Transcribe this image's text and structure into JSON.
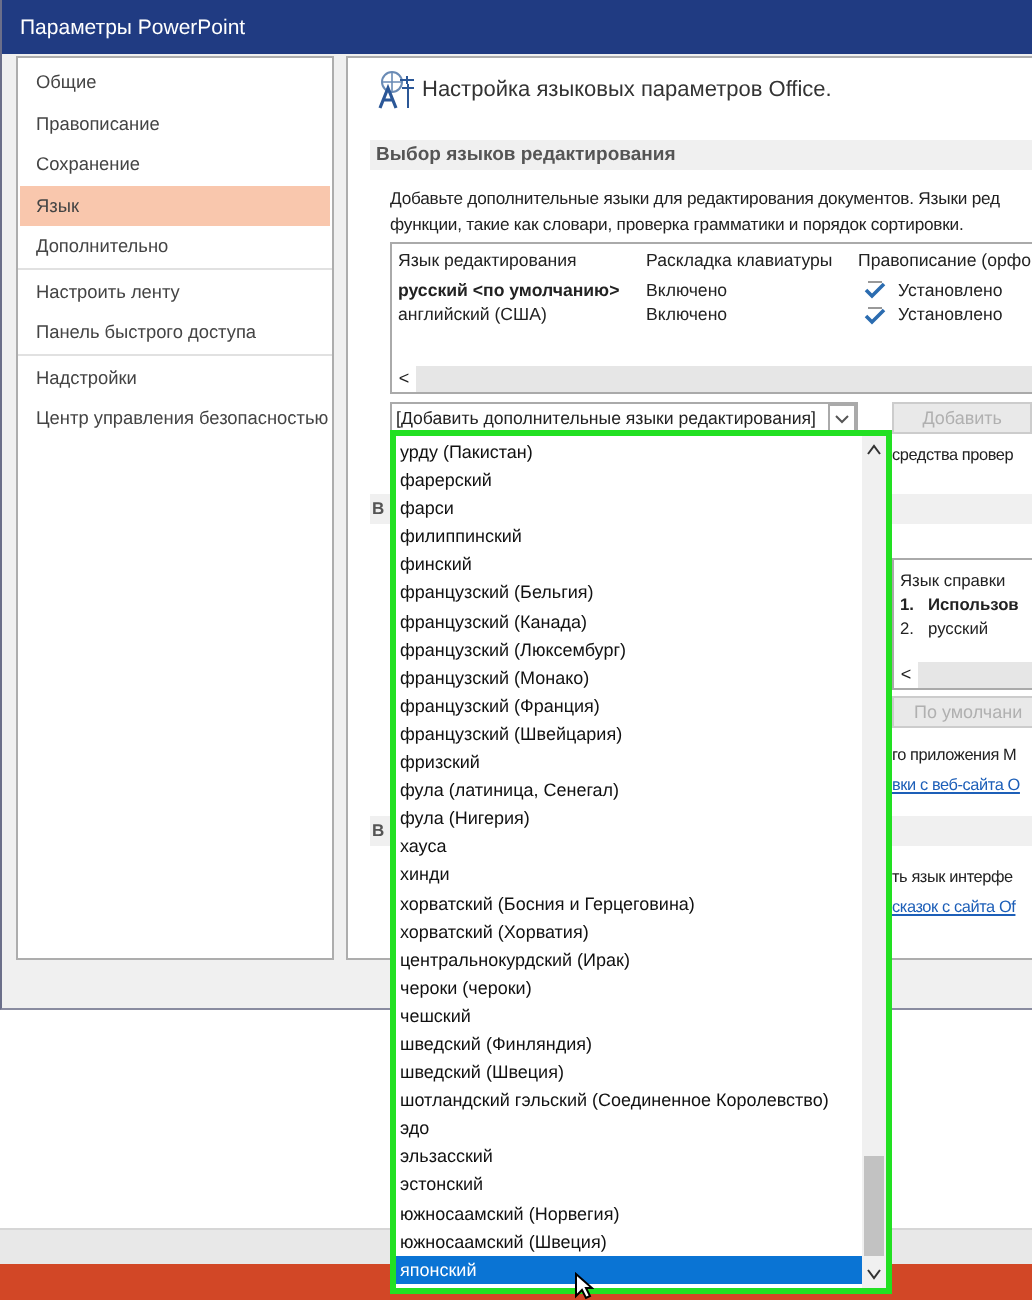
{
  "window": {
    "title": "Параметры PowerPoint"
  },
  "sidebar": {
    "groups": [
      [
        {
          "label": "Общие",
          "selected": false
        },
        {
          "label": "Правописание",
          "selected": false
        },
        {
          "label": "Сохранение",
          "selected": false
        },
        {
          "label": "Язык",
          "selected": true
        },
        {
          "label": "Дополнительно",
          "selected": false
        }
      ],
      [
        {
          "label": "Настроить ленту",
          "selected": false
        },
        {
          "label": "Панель быстрого доступа",
          "selected": false
        }
      ],
      [
        {
          "label": "Надстройки",
          "selected": false
        },
        {
          "label": "Центр управления безопасностью",
          "selected": false
        }
      ]
    ]
  },
  "main": {
    "heading": "Настройка языковых параметров Office.",
    "section_title": "Выбор языков редактирования",
    "description": [
      "Добавьте дополнительные языки для редактирования документов. Языки ред",
      "функции, такие как словари, проверка грамматики и порядок сортировки."
    ],
    "table": {
      "columns": [
        "Язык редактирования",
        "Раскладка клавиатуры",
        "Правописание (орфо"
      ],
      "rows": [
        {
          "language": "русский <по умолчанию>",
          "default": true,
          "keyboard": "Включено",
          "proofing": "Установлено"
        },
        {
          "language": "английский (США)",
          "default": false,
          "keyboard": "Включено",
          "proofing": "Установлено"
        }
      ],
      "scroll_left": "<"
    },
    "combo": {
      "value": "[Добавить дополнительные языки редактирования]"
    },
    "add_button": {
      "label": "Добавить",
      "disabled": true
    },
    "proofing_note": "средства провер",
    "section2_title": "В",
    "help_table": {
      "columns": [
        "Язык справки"
      ],
      "rows": [
        {
          "number": "1.",
          "label": "Использов",
          "default": true
        },
        {
          "number": "2.",
          "label": "русский",
          "default": false
        }
      ],
      "scroll_left": "<"
    },
    "default_button": {
      "label": "По умолчани",
      "disabled": true
    },
    "help_note": "го приложения M",
    "help_link": "вки с веб-сайта O",
    "section3_title": "В",
    "ui_note": "ть язык интерфе",
    "ui_link": "сказок с сайта Of"
  },
  "dropdown": {
    "items": [
      {
        "label": "урду (Пакистан)",
        "selected": false
      },
      {
        "label": "фарерский",
        "selected": false
      },
      {
        "label": "фарси",
        "selected": false
      },
      {
        "label": "филиппинский",
        "selected": false
      },
      {
        "label": "финский",
        "selected": false
      },
      {
        "label": "французский (Бельгия)",
        "selected": false
      },
      {
        "label": "французский (Канада)",
        "selected": false
      },
      {
        "label": "французский (Люксембург)",
        "selected": false
      },
      {
        "label": "французский (Монако)",
        "selected": false
      },
      {
        "label": "французский (Франция)",
        "selected": false
      },
      {
        "label": "французский (Швейцария)",
        "selected": false
      },
      {
        "label": "фризский",
        "selected": false
      },
      {
        "label": "фула (латиница, Сенегал)",
        "selected": false
      },
      {
        "label": "фула (Нигерия)",
        "selected": false
      },
      {
        "label": "хауса",
        "selected": false
      },
      {
        "label": "хинди",
        "selected": false
      },
      {
        "label": "хорватский (Босния и Герцеговина)",
        "selected": false
      },
      {
        "label": "хорватский (Хорватия)",
        "selected": false
      },
      {
        "label": "центральнокурдский (Ирак)",
        "selected": false
      },
      {
        "label": "чероки (чероки)",
        "selected": false
      },
      {
        "label": "чешский",
        "selected": false
      },
      {
        "label": "шведский (Финляндия)",
        "selected": false
      },
      {
        "label": "шведский (Швеция)",
        "selected": false
      },
      {
        "label": "шотландский гэльский (Соединенное Королевство)",
        "selected": false
      },
      {
        "label": "эдо",
        "selected": false
      },
      {
        "label": "эльзасский",
        "selected": false
      },
      {
        "label": "эстонский",
        "selected": false
      },
      {
        "label": "южносаамский (Норвегия)",
        "selected": false
      },
      {
        "label": "южносаамский (Швеция)",
        "selected": false
      },
      {
        "label": "японский",
        "selected": true
      }
    ]
  }
}
